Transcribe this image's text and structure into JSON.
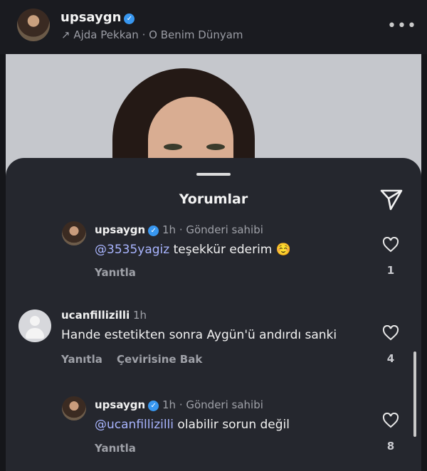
{
  "post": {
    "username": "upsaygn",
    "music": "Ajda Pekkan · O Benim Dünyam",
    "music_prefix": "↗",
    "more": "•••"
  },
  "sheet": {
    "title": "Yorumlar"
  },
  "comments": [
    {
      "username": "upsaygn",
      "time": "1h",
      "tag": "Gönderi sahibi",
      "mention": "@3535yagiz",
      "text": " teşekkür ederim ☺️",
      "reply": "Yanıtla",
      "likes": "1"
    },
    {
      "username": "ucanfillizilli",
      "time": "1h",
      "text": "Hande estetikten sonra Aygün'ü andırdı sanki",
      "reply": "Yanıtla",
      "translate": "Çevirisine Bak",
      "likes": "4"
    },
    {
      "username": "upsaygn",
      "time": "1h",
      "tag": "Gönderi sahibi",
      "mention": "@ucanfillizilli",
      "text": " olabilir sorun değil",
      "reply": "Yanıtla",
      "likes": "8"
    }
  ],
  "icons": {
    "verified": "verified-badge-icon",
    "send": "send-icon",
    "heart": "heart-icon",
    "more": "more-icon"
  },
  "colors": {
    "verified": "#3897f0",
    "mention": "#a9b5ff",
    "sheet_bg": "#25272e"
  }
}
